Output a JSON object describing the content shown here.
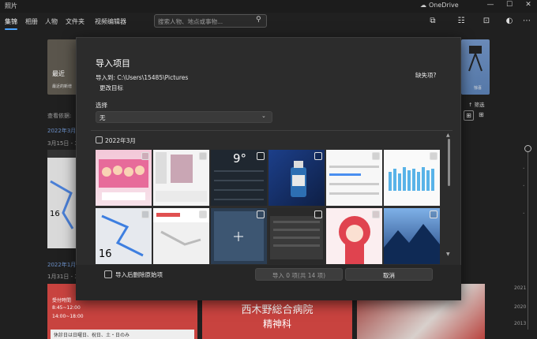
{
  "window": {
    "title": "照片",
    "onedrive": "OneDrive"
  },
  "nav": {
    "tabs": [
      {
        "label": "集锦"
      },
      {
        "label": "相册"
      },
      {
        "label": "人物"
      },
      {
        "label": "文件夹"
      },
      {
        "label": "视频编辑器"
      }
    ],
    "search_placeholder": "搜索人物、地点或事物..."
  },
  "background": {
    "recent_label": "最近",
    "recent_sub": "最近的新增",
    "right_sub": "惊喜",
    "view_label": "查看依据:",
    "filter_label": "筛选",
    "date1": "2022年3月",
    "date1_range": "3月15日 - 3",
    "date2": "2022年1月",
    "date2_range": "1月31日 - 3",
    "hospital_line1": "西木野総合病院",
    "hospital_line2": "精神科",
    "schedule": [
      "受付時間",
      "8:45~12:00",
      "14:00~18:00"
    ],
    "bottom_text": "休診日は日曜日、祝日、土・日のみ",
    "years": [
      "2021",
      "2020",
      "2013"
    ]
  },
  "dialog": {
    "title": "导入项目",
    "import_to_label": "导入到:",
    "import_path": "C:\\Users\\15485\\Pictures",
    "change_target": "更改目标",
    "missing_items": "缺失项?",
    "select_label": "选择",
    "select_value": "无",
    "group_label": "2022年3月",
    "delete_after_label": "导入后删除原始项",
    "import_button": "导入 0 项(共 14 项)",
    "cancel_button": "取消",
    "thumb_weather_text": "9°"
  }
}
